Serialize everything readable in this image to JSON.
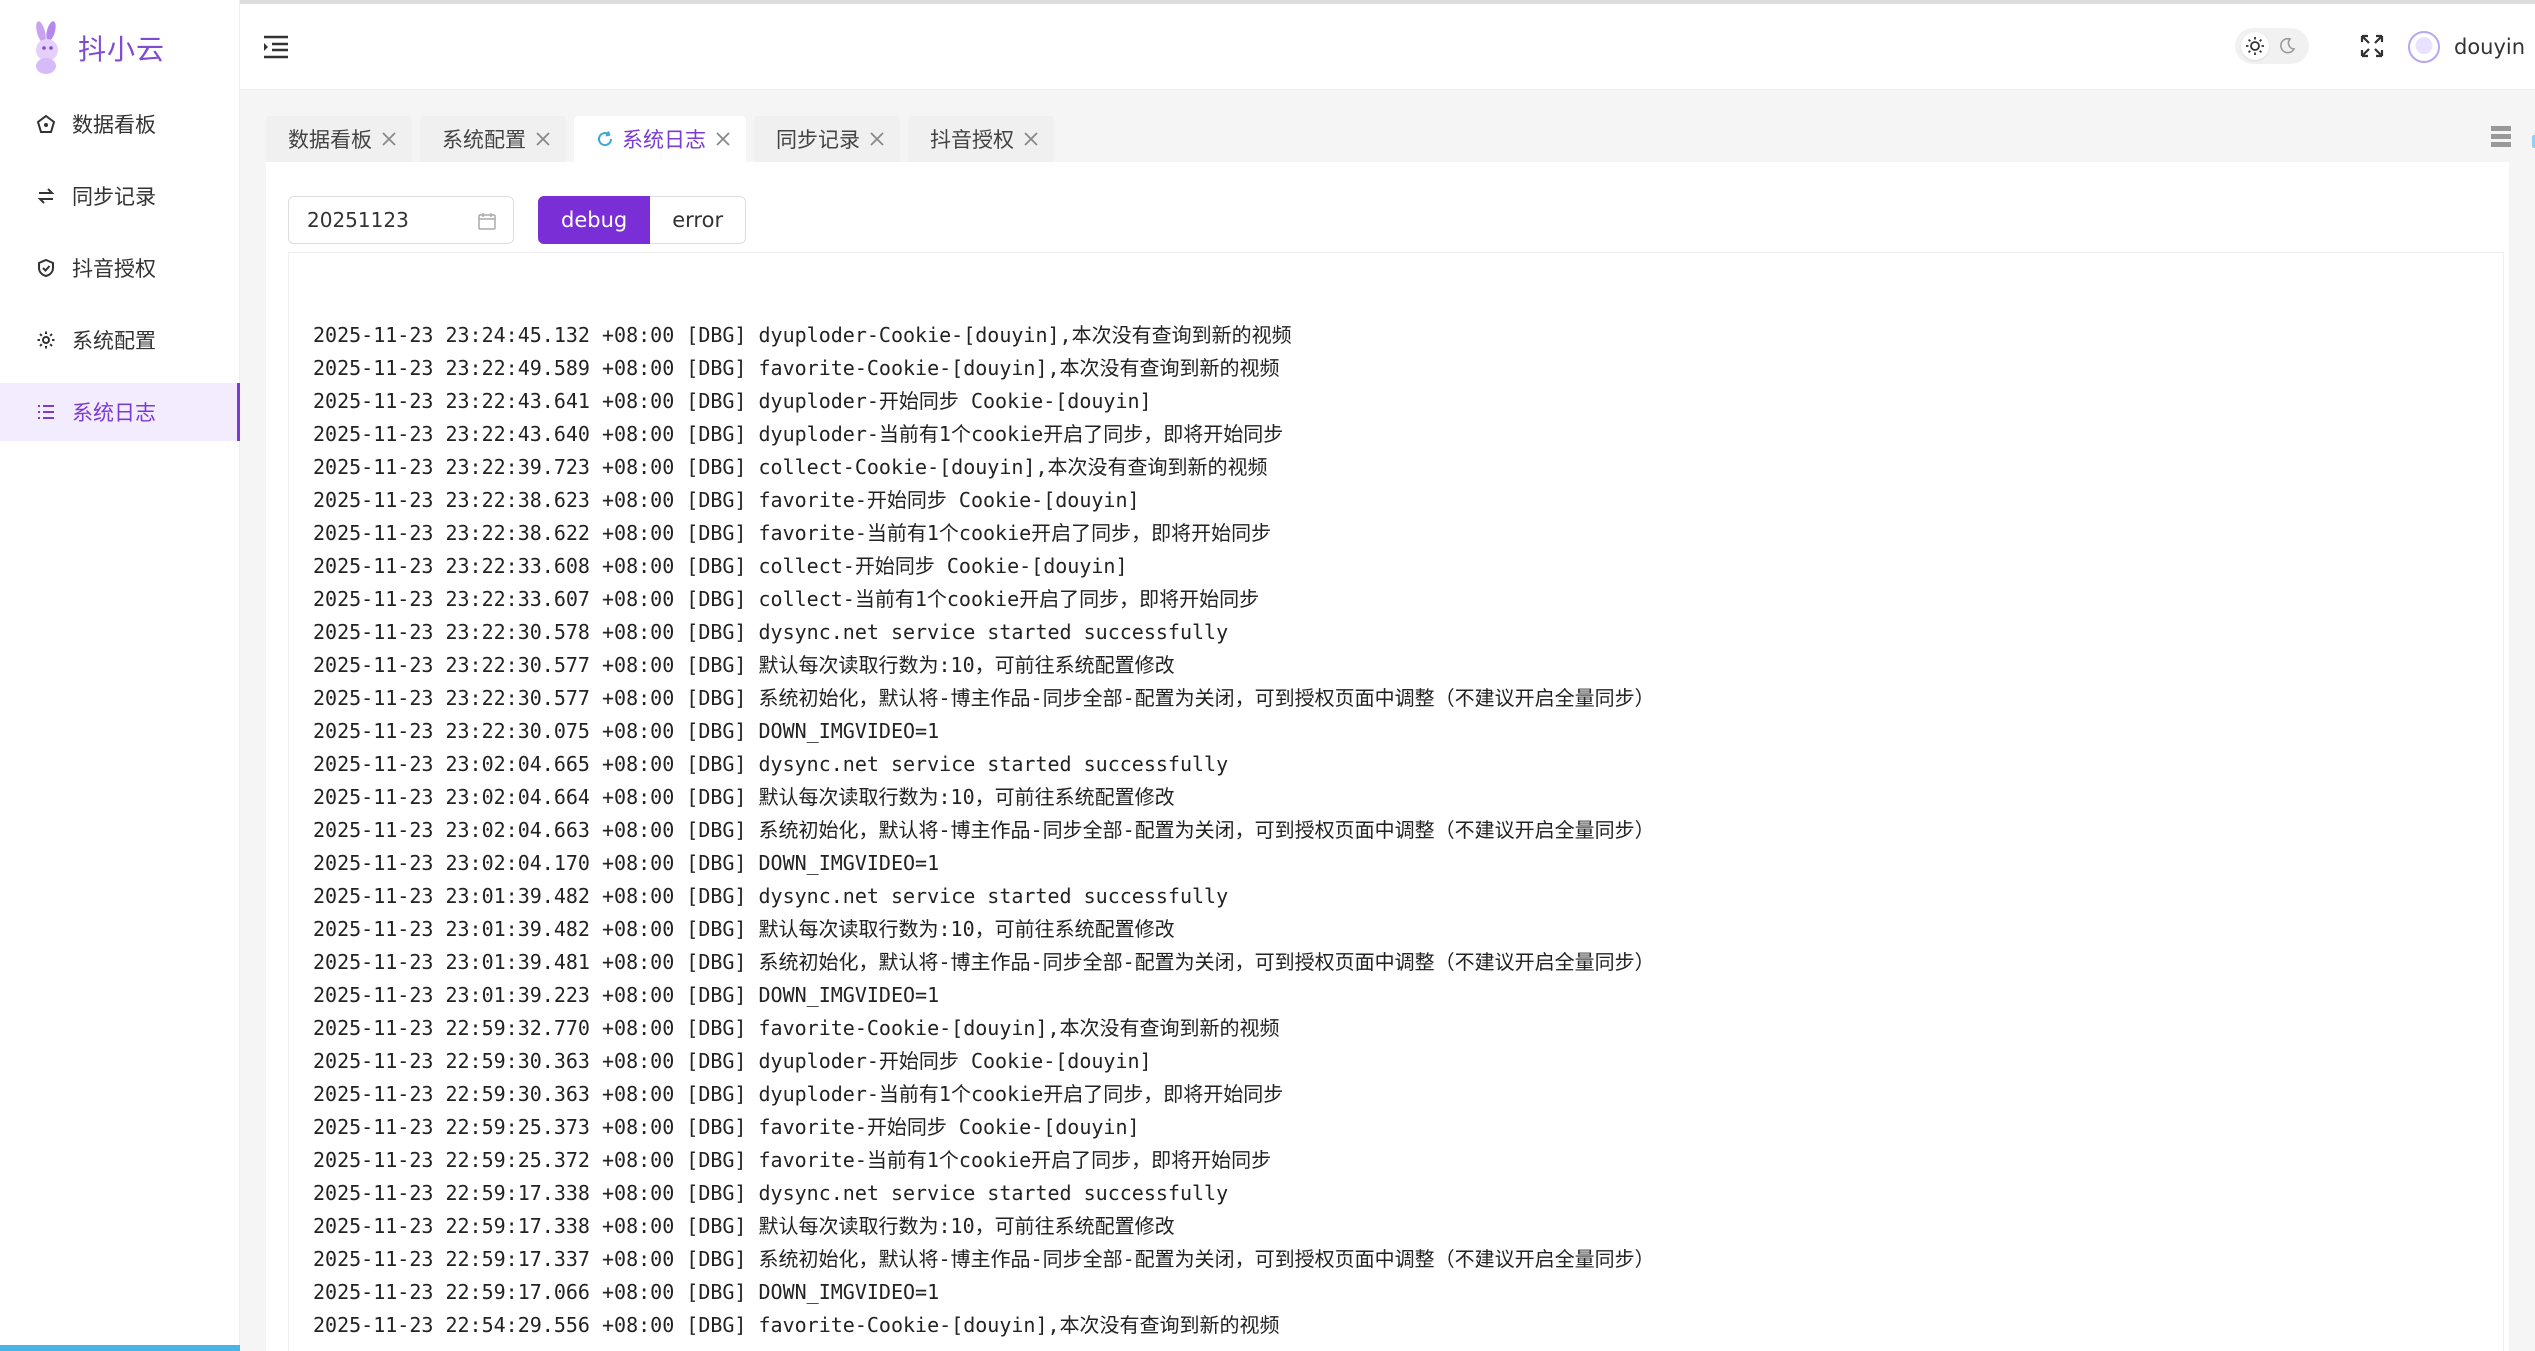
{
  "brand": {
    "name": "抖小云"
  },
  "nav": [
    {
      "label": "数据看板",
      "icon": "dashboard-icon",
      "active": false
    },
    {
      "label": "同步记录",
      "icon": "sync-icon",
      "active": false
    },
    {
      "label": "抖音授权",
      "icon": "shield-icon",
      "active": false
    },
    {
      "label": "系统配置",
      "icon": "gear-icon",
      "active": false
    },
    {
      "label": "系统日志",
      "icon": "list-icon",
      "active": true
    }
  ],
  "header": {
    "username": "douyin"
  },
  "tabs": [
    {
      "label": "数据看板",
      "active": false
    },
    {
      "label": "系统配置",
      "active": false
    },
    {
      "label": "系统日志",
      "active": true
    },
    {
      "label": "同步记录",
      "active": false
    },
    {
      "label": "抖音授权",
      "active": false
    }
  ],
  "filters": {
    "date": "20251123",
    "levels": [
      {
        "label": "debug",
        "active": true
      },
      {
        "label": "error",
        "active": false
      }
    ]
  },
  "logs": [
    "2025-11-23 23:24:45.132 +08:00 [DBG] dyuploder-Cookie-[douyin],本次没有查询到新的视频",
    "2025-11-23 23:22:49.589 +08:00 [DBG] favorite-Cookie-[douyin],本次没有查询到新的视频",
    "2025-11-23 23:22:43.641 +08:00 [DBG] dyuploder-开始同步 Cookie-[douyin]",
    "2025-11-23 23:22:43.640 +08:00 [DBG] dyuploder-当前有1个cookie开启了同步，即将开始同步",
    "2025-11-23 23:22:39.723 +08:00 [DBG] collect-Cookie-[douyin],本次没有查询到新的视频",
    "2025-11-23 23:22:38.623 +08:00 [DBG] favorite-开始同步 Cookie-[douyin]",
    "2025-11-23 23:22:38.622 +08:00 [DBG] favorite-当前有1个cookie开启了同步，即将开始同步",
    "2025-11-23 23:22:33.608 +08:00 [DBG] collect-开始同步 Cookie-[douyin]",
    "2025-11-23 23:22:33.607 +08:00 [DBG] collect-当前有1个cookie开启了同步，即将开始同步",
    "2025-11-23 23:22:30.578 +08:00 [DBG] dysync.net service started successfully",
    "2025-11-23 23:22:30.577 +08:00 [DBG] 默认每次读取行数为:10，可前往系统配置修改",
    "2025-11-23 23:22:30.577 +08:00 [DBG] 系统初始化，默认将-博主作品-同步全部-配置为关闭，可到授权页面中调整（不建议开启全量同步）",
    "2025-11-23 23:22:30.075 +08:00 [DBG] DOWN_IMGVIDEO=1",
    "2025-11-23 23:02:04.665 +08:00 [DBG] dysync.net service started successfully",
    "2025-11-23 23:02:04.664 +08:00 [DBG] 默认每次读取行数为:10，可前往系统配置修改",
    "2025-11-23 23:02:04.663 +08:00 [DBG] 系统初始化，默认将-博主作品-同步全部-配置为关闭，可到授权页面中调整（不建议开启全量同步）",
    "2025-11-23 23:02:04.170 +08:00 [DBG] DOWN_IMGVIDEO=1",
    "2025-11-23 23:01:39.482 +08:00 [DBG] dysync.net service started successfully",
    "2025-11-23 23:01:39.482 +08:00 [DBG] 默认每次读取行数为:10，可前往系统配置修改",
    "2025-11-23 23:01:39.481 +08:00 [DBG] 系统初始化，默认将-博主作品-同步全部-配置为关闭，可到授权页面中调整（不建议开启全量同步）",
    "2025-11-23 23:01:39.223 +08:00 [DBG] DOWN_IMGVIDEO=1",
    "2025-11-23 22:59:32.770 +08:00 [DBG] favorite-Cookie-[douyin],本次没有查询到新的视频",
    "2025-11-23 22:59:30.363 +08:00 [DBG] dyuploder-开始同步 Cookie-[douyin]",
    "2025-11-23 22:59:30.363 +08:00 [DBG] dyuploder-当前有1个cookie开启了同步，即将开始同步",
    "2025-11-23 22:59:25.373 +08:00 [DBG] favorite-开始同步 Cookie-[douyin]",
    "2025-11-23 22:59:25.372 +08:00 [DBG] favorite-当前有1个cookie开启了同步，即将开始同步",
    "2025-11-23 22:59:17.338 +08:00 [DBG] dysync.net service started successfully",
    "2025-11-23 22:59:17.338 +08:00 [DBG] 默认每次读取行数为:10，可前往系统配置修改",
    "2025-11-23 22:59:17.337 +08:00 [DBG] 系统初始化，默认将-博主作品-同步全部-配置为关闭，可到授权页面中调整（不建议开启全量同步）",
    "2025-11-23 22:59:17.066 +08:00 [DBG] DOWN_IMGVIDEO=1",
    "2025-11-23 22:54:29.556 +08:00 [DBG] favorite-Cookie-[douyin],本次没有查询到新的视频"
  ],
  "colors": {
    "accent": "#7a2ed6",
    "brand": "#7f4bd0",
    "highlight_bg": "#f3ecff"
  }
}
